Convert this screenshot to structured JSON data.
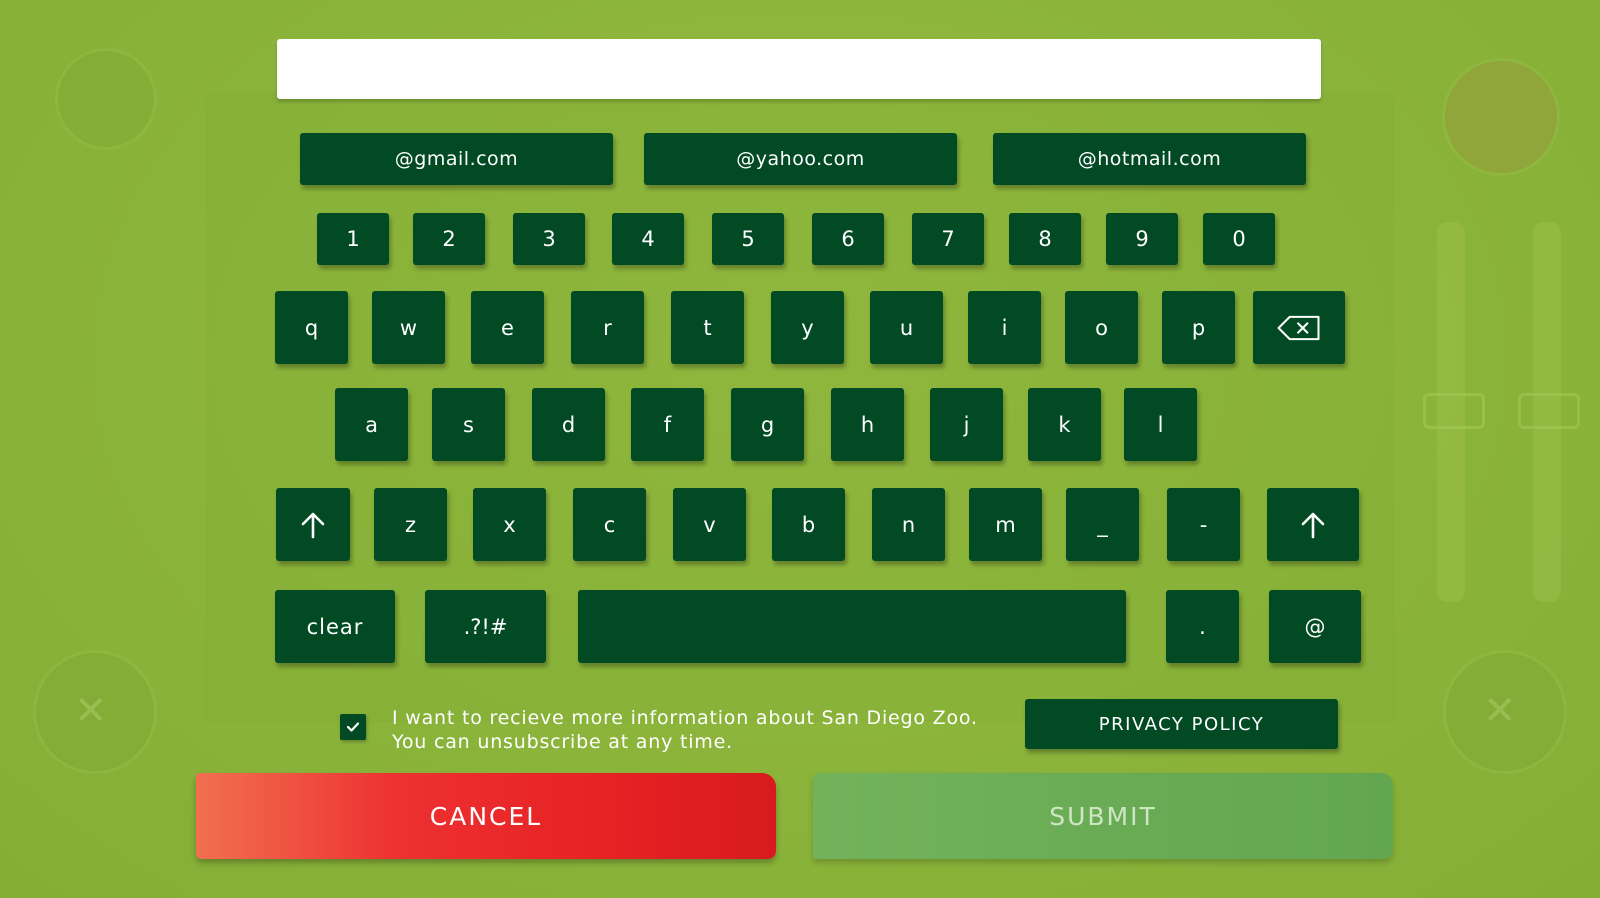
{
  "input": {
    "value": ""
  },
  "domains": [
    "@gmail.com",
    "@yahoo.com",
    "@hotmail.com"
  ],
  "rows": {
    "numbers": [
      "1",
      "2",
      "3",
      "4",
      "5",
      "6",
      "7",
      "8",
      "9",
      "0"
    ],
    "row1": [
      "q",
      "w",
      "e",
      "r",
      "t",
      "y",
      "u",
      "i",
      "o",
      "p"
    ],
    "row2": [
      "a",
      "s",
      "d",
      "f",
      "g",
      "h",
      "j",
      "k",
      "l"
    ],
    "row3": [
      "z",
      "x",
      "c",
      "v",
      "b",
      "n",
      "m",
      "_",
      "-"
    ],
    "row4": {
      "clear": "clear",
      "symbols": ".?!#",
      "period": ".",
      "at": "@"
    }
  },
  "icons": {
    "backspace": "backspace-icon",
    "shift": "shift-arrow-icon",
    "check": "check-icon",
    "close": "close-icon"
  },
  "consent": {
    "line1": "I want to recieve more information about San Diego Zoo.",
    "line2": "You can unsubscribe at any time.",
    "checked": true
  },
  "privacy_label": "PRIVACY POLICY",
  "cancel_label": "CANCEL",
  "submit_label": "SUBMIT",
  "colors": {
    "background": "#8cb43a",
    "key": "#024a24",
    "cancel": "#e62224",
    "submit": "#6aac55"
  }
}
